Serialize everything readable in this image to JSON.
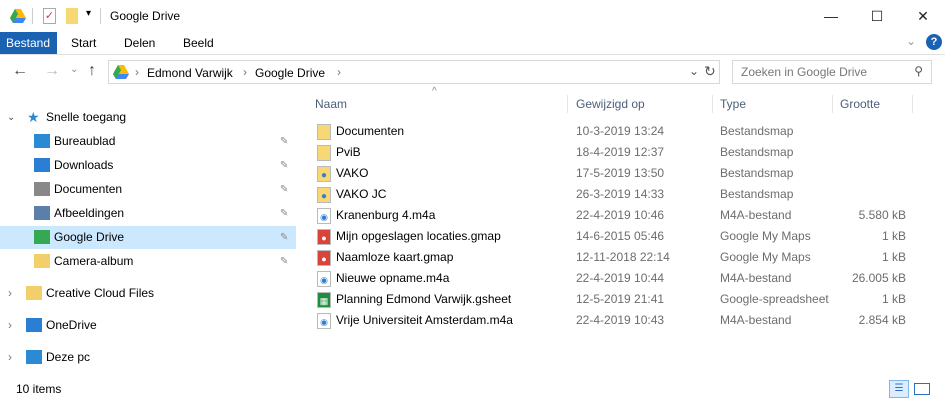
{
  "window": {
    "title": "Google Drive",
    "minimize": "—",
    "maximize": "☐",
    "close": "✕"
  },
  "ribbon": {
    "tabs": [
      "Bestand",
      "Start",
      "Delen",
      "Beeld"
    ],
    "help": "?",
    "expand": "⌄"
  },
  "nav_buttons": {
    "back": "←",
    "forward": "→",
    "recent": "⌄",
    "up": "↑"
  },
  "address": {
    "crumbs": [
      "Edmond Varwijk",
      "Google Drive"
    ],
    "sep": "›",
    "dropdown": "⌄",
    "refresh": "↻"
  },
  "search": {
    "placeholder": "Zoeken in Google Drive",
    "icon": "⚲"
  },
  "sidebar": {
    "quick_access": "Snelle toegang",
    "quick_items": [
      {
        "label": "Bureaublad",
        "icon": "desktop-icon",
        "color": "#2a8ad4"
      },
      {
        "label": "Downloads",
        "icon": "download-icon",
        "color": "#2a7fd4"
      },
      {
        "label": "Documenten",
        "icon": "document-icon",
        "color": "#888888"
      },
      {
        "label": "Afbeeldingen",
        "icon": "pictures-icon",
        "color": "#5a7fa8"
      },
      {
        "label": "Google Drive",
        "icon": "google-drive-icon",
        "color": "#34a853"
      },
      {
        "label": "Camera-album",
        "icon": "camera-folder-icon",
        "color": "#f2cf6a"
      }
    ],
    "roots": [
      {
        "label": "Creative Cloud Files",
        "icon": "creative-cloud-icon",
        "color": "#f2cf6a"
      },
      {
        "label": "OneDrive",
        "icon": "onedrive-icon",
        "color": "#2a7fd4"
      },
      {
        "label": "Deze pc",
        "icon": "computer-icon",
        "color": "#2a8ad4"
      }
    ]
  },
  "columns": [
    "Naam",
    "Gewijzigd op",
    "Type",
    "Grootte"
  ],
  "files": [
    {
      "name": "Documenten",
      "date": "10-3-2019 13:24",
      "type": "Bestandsmap",
      "size": "",
      "icon": "folder"
    },
    {
      "name": "PviB",
      "date": "18-4-2019 12:37",
      "type": "Bestandsmap",
      "size": "",
      "icon": "folder"
    },
    {
      "name": "VAKO",
      "date": "17-5-2019 13:50",
      "type": "Bestandsmap",
      "size": "",
      "icon": "shared-folder"
    },
    {
      "name": "VAKO JC",
      "date": "26-3-2019 14:33",
      "type": "Bestandsmap",
      "size": "",
      "icon": "shared-folder"
    },
    {
      "name": "Kranenburg 4.m4a",
      "date": "22-4-2019 10:46",
      "type": "M4A-bestand",
      "size": "5.580 kB",
      "icon": "audio"
    },
    {
      "name": "Mijn opgeslagen locaties.gmap",
      "date": "14-6-2015 05:46",
      "type": "Google My Maps",
      "size": "1 kB",
      "icon": "map"
    },
    {
      "name": "Naamloze kaart.gmap",
      "date": "12-11-2018 22:14",
      "type": "Google My Maps",
      "size": "1 kB",
      "icon": "map"
    },
    {
      "name": "Nieuwe opname.m4a",
      "date": "22-4-2019 10:44",
      "type": "M4A-bestand",
      "size": "26.005 kB",
      "icon": "audio"
    },
    {
      "name": "Planning Edmond Varwijk.gsheet",
      "date": "12-5-2019 21:41",
      "type": "Google-spreadsheet",
      "size": "1 kB",
      "icon": "sheet"
    },
    {
      "name": "Vrije Universiteit Amsterdam.m4a",
      "date": "22-4-2019 10:43",
      "type": "M4A-bestand",
      "size": "2.854 kB",
      "icon": "audio"
    }
  ],
  "status": {
    "count": "10 items"
  }
}
